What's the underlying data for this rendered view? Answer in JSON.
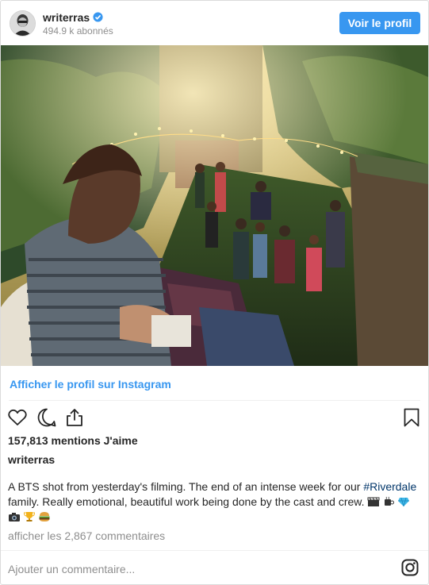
{
  "header": {
    "username": "writerras",
    "followers": "494.9 k abonnés",
    "view_profile_label": "Voir le profil",
    "verified_icon": "verified-badge-icon",
    "verified_color": "#3897f0"
  },
  "photo": {
    "description_icon": "garden-party-photo"
  },
  "links": {
    "view_on_instagram": "Afficher le profil sur Instagram"
  },
  "actions": {
    "like_icon": "heart-icon",
    "comment_icon": "comment-icon",
    "share_icon": "share-icon",
    "save_icon": "bookmark-icon"
  },
  "post": {
    "likes": "157,813 mentions J'aime",
    "author": "writerras",
    "caption_before": "A BTS shot from yesterday's filming. The end of an intense week for our ",
    "hashtag": "#Riverdale",
    "caption_after": " family. Really emotional, beautiful work being done by the cast and crew. ",
    "emojis_line1": [
      "clapper-board-emoji",
      "coffee-emoji",
      "gem-emoji"
    ],
    "emojis_line2": [
      "camera-emoji",
      "trophy-emoji",
      "burger-emoji"
    ],
    "view_comments": "afficher les 2,867 commentaires"
  },
  "comment_box": {
    "placeholder": "Ajouter un commentaire..."
  },
  "colors": {
    "accent": "#3897f0",
    "hashtag": "#003569",
    "muted": "#8e8e8e",
    "text": "#262626"
  }
}
